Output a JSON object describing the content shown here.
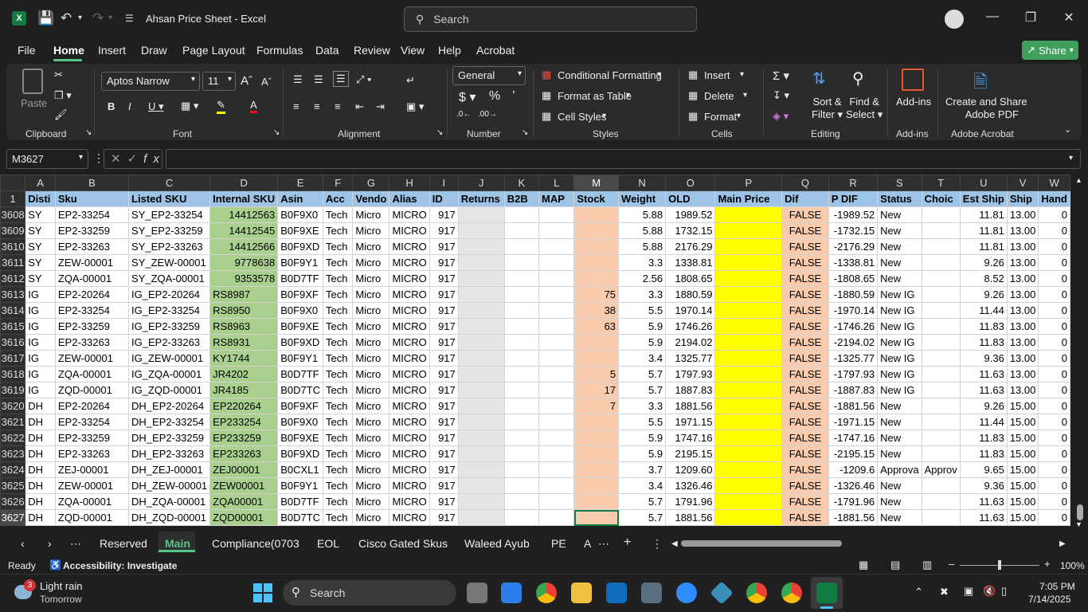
{
  "window": {
    "title": "Ahsan Price Sheet - Excel",
    "search_placeholder": "Search"
  },
  "menu": [
    "File",
    "Home",
    "Insert",
    "Draw",
    "Page Layout",
    "Formulas",
    "Data",
    "Review",
    "View",
    "Help",
    "Acrobat"
  ],
  "share_label": "Share",
  "ribbon": {
    "clipboard": {
      "label": "Clipboard",
      "paste": "Paste"
    },
    "font": {
      "label": "Font",
      "name": "Aptos Narrow",
      "size": "11"
    },
    "alignment": {
      "label": "Alignment"
    },
    "number": {
      "label": "Number",
      "format": "General"
    },
    "styles": {
      "label": "Styles",
      "conditional": "Conditional Formatting",
      "table": "Format as Table",
      "cell_styles": "Cell Styles"
    },
    "cells": {
      "label": "Cells",
      "insert": "Insert",
      "delete": "Delete",
      "format": "Format"
    },
    "editing": {
      "label": "Editing",
      "sort1": "Sort &",
      "sort2": "Filter",
      "find1": "Find &",
      "find2": "Select"
    },
    "addins": {
      "label": "Add-ins",
      "btn": "Add-ins"
    },
    "acrobat": {
      "label": "Adobe Acrobat",
      "btn1": "Create and Share",
      "btn2": "Adobe PDF"
    }
  },
  "namebox": "M3627",
  "columns": [
    "A",
    "B",
    "C",
    "D",
    "E",
    "F",
    "G",
    "H",
    "I",
    "J",
    "K",
    "L",
    "M",
    "N",
    "O",
    "P",
    "Q",
    "R",
    "S",
    "T",
    "U",
    "V",
    "W"
  ],
  "header_row": {
    "num": "1",
    "cells": [
      "Disti",
      "Sku",
      "Listed SKU",
      "Internal SKU",
      "Asin",
      "Acc",
      "Vendo",
      "Alias",
      "ID",
      "Returns",
      "B2B",
      "MAP",
      "Stock",
      "Weight",
      "OLD",
      "Main Price",
      "Dif",
      "P DIF",
      "Status",
      "Choic",
      "Est Ship",
      "Ship",
      "Hand"
    ]
  },
  "rows": [
    {
      "n": "3608",
      "a": "SY",
      "b": "EP2-33254",
      "c": "SY_EP2-33254",
      "d": "14412563",
      "e": "B0F9X0",
      "f": "Tech",
      "g": "Micro",
      "h": "MICRO",
      "i": "917",
      "m": "",
      "nw": "5.88",
      "o": "1989.52",
      "q": "FALSE",
      "r": "-1989.52",
      "s": "New",
      "t": "",
      "u": "11.81",
      "v": "13.00",
      "w": "0"
    },
    {
      "n": "3609",
      "a": "SY",
      "b": "EP2-33259",
      "c": "SY_EP2-33259",
      "d": "14412545",
      "e": "B0F9XE",
      "f": "Tech",
      "g": "Micro",
      "h": "MICRO",
      "i": "917",
      "m": "",
      "nw": "5.88",
      "o": "1732.15",
      "q": "FALSE",
      "r": "-1732.15",
      "s": "New",
      "t": "",
      "u": "11.81",
      "v": "13.00",
      "w": "0"
    },
    {
      "n": "3610",
      "a": "SY",
      "b": "EP2-33263",
      "c": "SY_EP2-33263",
      "d": "14412566",
      "e": "B0F9XD",
      "f": "Tech",
      "g": "Micro",
      "h": "MICRO",
      "i": "917",
      "m": "",
      "nw": "5.88",
      "o": "2176.29",
      "q": "FALSE",
      "r": "-2176.29",
      "s": "New",
      "t": "",
      "u": "11.81",
      "v": "13.00",
      "w": "0"
    },
    {
      "n": "3611",
      "a": "SY",
      "b": "ZEW-00001",
      "c": "SY_ZEW-00001",
      "d": "9778638",
      "e": "B0F9Y1",
      "f": "Tech",
      "g": "Micro",
      "h": "MICRO",
      "i": "917",
      "m": "",
      "nw": "3.3",
      "o": "1338.81",
      "q": "FALSE",
      "r": "-1338.81",
      "s": "New",
      "t": "",
      "u": "9.26",
      "v": "13.00",
      "w": "0"
    },
    {
      "n": "3612",
      "a": "SY",
      "b": "ZQA-00001",
      "c": "SY_ZQA-00001",
      "d": "9353578",
      "e": "B0D7TF",
      "f": "Tech",
      "g": "Micro",
      "h": "MICRO",
      "i": "917",
      "m": "",
      "nw": "2.56",
      "o": "1808.65",
      "q": "FALSE",
      "r": "-1808.65",
      "s": "New",
      "t": "",
      "u": "8.52",
      "v": "13.00",
      "w": "0"
    },
    {
      "n": "3613",
      "a": "IG",
      "b": "EP2-20264",
      "c": "IG_EP2-20264",
      "d": "RS8987",
      "e": "B0F9XF",
      "f": "Tech",
      "g": "Micro",
      "h": "MICRO",
      "i": "917",
      "m": "75",
      "nw": "3.3",
      "o": "1880.59",
      "q": "FALSE",
      "r": "-1880.59",
      "s": "New IG",
      "t": "",
      "u": "9.26",
      "v": "13.00",
      "w": "0"
    },
    {
      "n": "3614",
      "a": "IG",
      "b": "EP2-33254",
      "c": "IG_EP2-33254",
      "d": "RS8950",
      "e": "B0F9X0",
      "f": "Tech",
      "g": "Micro",
      "h": "MICRO",
      "i": "917",
      "m": "38",
      "nw": "5.5",
      "o": "1970.14",
      "q": "FALSE",
      "r": "-1970.14",
      "s": "New IG",
      "t": "",
      "u": "11.44",
      "v": "13.00",
      "w": "0"
    },
    {
      "n": "3615",
      "a": "IG",
      "b": "EP2-33259",
      "c": "IG_EP2-33259",
      "d": "RS8963",
      "e": "B0F9XE",
      "f": "Tech",
      "g": "Micro",
      "h": "MICRO",
      "i": "917",
      "m": "63",
      "nw": "5.9",
      "o": "1746.26",
      "q": "FALSE",
      "r": "-1746.26",
      "s": "New IG",
      "t": "",
      "u": "11.83",
      "v": "13.00",
      "w": "0"
    },
    {
      "n": "3616",
      "a": "IG",
      "b": "EP2-33263",
      "c": "IG_EP2-33263",
      "d": "RS8931",
      "e": "B0F9XD",
      "f": "Tech",
      "g": "Micro",
      "h": "MICRO",
      "i": "917",
      "m": "",
      "nw": "5.9",
      "o": "2194.02",
      "q": "FALSE",
      "r": "-2194.02",
      "s": "New IG",
      "t": "",
      "u": "11.83",
      "v": "13.00",
      "w": "0"
    },
    {
      "n": "3617",
      "a": "IG",
      "b": "ZEW-00001",
      "c": "IG_ZEW-00001",
      "d": "KY1744",
      "e": "B0F9Y1",
      "f": "Tech",
      "g": "Micro",
      "h": "MICRO",
      "i": "917",
      "m": "",
      "nw": "3.4",
      "o": "1325.77",
      "q": "FALSE",
      "r": "-1325.77",
      "s": "New IG",
      "t": "",
      "u": "9.36",
      "v": "13.00",
      "w": "0"
    },
    {
      "n": "3618",
      "a": "IG",
      "b": "ZQA-00001",
      "c": "IG_ZQA-00001",
      "d": "JR4202",
      "e": "B0D7TF",
      "f": "Tech",
      "g": "Micro",
      "h": "MICRO",
      "i": "917",
      "m": "5",
      "nw": "5.7",
      "o": "1797.93",
      "q": "FALSE",
      "r": "-1797.93",
      "s": "New IG",
      "t": "",
      "u": "11.63",
      "v": "13.00",
      "w": "0"
    },
    {
      "n": "3619",
      "a": "IG",
      "b": "ZQD-00001",
      "c": "IG_ZQD-00001",
      "d": "JR4185",
      "e": "B0D7TC",
      "f": "Tech",
      "g": "Micro",
      "h": "MICRO",
      "i": "917",
      "m": "17",
      "nw": "5.7",
      "o": "1887.83",
      "q": "FALSE",
      "r": "-1887.83",
      "s": "New IG",
      "t": "",
      "u": "11.63",
      "v": "13.00",
      "w": "0"
    },
    {
      "n": "3620",
      "a": "DH",
      "b": "EP2-20264",
      "c": "DH_EP2-20264",
      "d": "EP220264",
      "e": "B0F9XF",
      "f": "Tech",
      "g": "Micro",
      "h": "MICRO",
      "i": "917",
      "m": "7",
      "nw": "3.3",
      "o": "1881.56",
      "q": "FALSE",
      "r": "-1881.56",
      "s": "New",
      "t": "",
      "u": "9.26",
      "v": "15.00",
      "w": "0"
    },
    {
      "n": "3621",
      "a": "DH",
      "b": "EP2-33254",
      "c": "DH_EP2-33254",
      "d": "EP233254",
      "e": "B0F9X0",
      "f": "Tech",
      "g": "Micro",
      "h": "MICRO",
      "i": "917",
      "m": "",
      "nw": "5.5",
      "o": "1971.15",
      "q": "FALSE",
      "r": "-1971.15",
      "s": "New",
      "t": "",
      "u": "11.44",
      "v": "15.00",
      "w": "0"
    },
    {
      "n": "3622",
      "a": "DH",
      "b": "EP2-33259",
      "c": "DH_EP2-33259",
      "d": "EP233259",
      "e": "B0F9XE",
      "f": "Tech",
      "g": "Micro",
      "h": "MICRO",
      "i": "917",
      "m": "",
      "nw": "5.9",
      "o": "1747.16",
      "q": "FALSE",
      "r": "-1747.16",
      "s": "New",
      "t": "",
      "u": "11.83",
      "v": "15.00",
      "w": "0"
    },
    {
      "n": "3623",
      "a": "DH",
      "b": "EP2-33263",
      "c": "DH_EP2-33263",
      "d": "EP233263",
      "e": "B0F9XD",
      "f": "Tech",
      "g": "Micro",
      "h": "MICRO",
      "i": "917",
      "m": "",
      "nw": "5.9",
      "o": "2195.15",
      "q": "FALSE",
      "r": "-2195.15",
      "s": "New",
      "t": "",
      "u": "11.83",
      "v": "15.00",
      "w": "0"
    },
    {
      "n": "3624",
      "a": "DH",
      "b": "ZEJ-00001",
      "c": "DH_ZEJ-00001",
      "d": "ZEJ00001",
      "e": "B0CXL1",
      "f": "Tech",
      "g": "Micro",
      "h": "MICRO",
      "i": "917",
      "m": "",
      "nw": "3.7",
      "o": "1209.60",
      "q": "FALSE",
      "r": "-1209.6",
      "s": "Approva",
      "t": "Approv",
      "u": "9.65",
      "v": "15.00",
      "w": "0"
    },
    {
      "n": "3625",
      "a": "DH",
      "b": "ZEW-00001",
      "c": "DH_ZEW-00001",
      "d": "ZEW00001",
      "e": "B0F9Y1",
      "f": "Tech",
      "g": "Micro",
      "h": "MICRO",
      "i": "917",
      "m": "",
      "nw": "3.4",
      "o": "1326.46",
      "q": "FALSE",
      "r": "-1326.46",
      "s": "New",
      "t": "",
      "u": "9.36",
      "v": "15.00",
      "w": "0"
    },
    {
      "n": "3626",
      "a": "DH",
      "b": "ZQA-00001",
      "c": "DH_ZQA-00001",
      "d": "ZQA00001",
      "e": "B0D7TF",
      "f": "Tech",
      "g": "Micro",
      "h": "MICRO",
      "i": "917",
      "m": "",
      "nw": "5.7",
      "o": "1791.96",
      "q": "FALSE",
      "r": "-1791.96",
      "s": "New",
      "t": "",
      "u": "11.63",
      "v": "15.00",
      "w": "0"
    },
    {
      "n": "3627",
      "a": "DH",
      "b": "ZQD-00001",
      "c": "DH_ZQD-00001",
      "d": "ZQD00001",
      "e": "B0D7TC",
      "f": "Tech",
      "g": "Micro",
      "h": "MICRO",
      "i": "917",
      "m": "",
      "nw": "5.7",
      "o": "1881.56",
      "q": "FALSE",
      "r": "-1881.56",
      "s": "New",
      "t": "",
      "u": "11.63",
      "v": "15.00",
      "w": "0"
    }
  ],
  "sheet_tabs": [
    "Reserved",
    "Main",
    "Compliance(0703",
    "EOL",
    "Cisco Gated Skus",
    "Waleed Ayub",
    "PE",
    "A"
  ],
  "status": {
    "ready": "Ready",
    "accessibility": "Accessibility: Investigate",
    "zoom": "100%"
  },
  "taskbar": {
    "weather_badge": "3",
    "weather": "Light rain",
    "weather_sub": "Tomorrow",
    "search": "Search",
    "time": "7:05 PM",
    "date": "7/14/2025"
  },
  "colors": {
    "header_blue": "#9dc3e6",
    "green": "#a9d08e",
    "peach": "#f8cbad",
    "yellow": "#ffff00",
    "excel_green": "#107c41"
  }
}
